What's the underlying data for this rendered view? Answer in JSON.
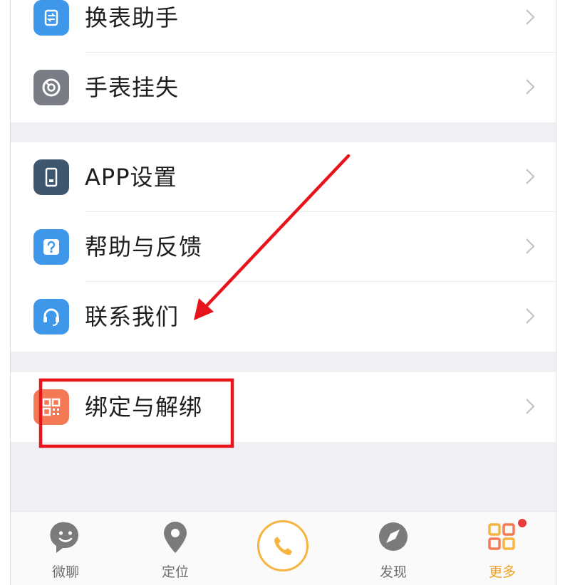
{
  "colors": {
    "accent": "#f7b43f",
    "annotation": "#e8141b",
    "icon_blue": "#3f97ea",
    "icon_gray": "#7a7d85",
    "icon_navy": "#3e566e",
    "icon_orange": "#f47a55"
  },
  "groups": [
    {
      "items": [
        {
          "label": "换表助手",
          "icon": "watch-swap-icon"
        },
        {
          "label": "手表挂失",
          "icon": "report-lost-icon"
        }
      ]
    },
    {
      "items": [
        {
          "label": "APP设置",
          "icon": "phone-settings-icon"
        },
        {
          "label": "帮助与反馈",
          "icon": "question-icon"
        },
        {
          "label": "联系我们",
          "icon": "headset-icon"
        }
      ]
    },
    {
      "items": [
        {
          "label": "绑定与解绑",
          "icon": "qr-code-icon"
        }
      ]
    }
  ],
  "tabbar": {
    "tabs": [
      {
        "label": "微聊",
        "icon": "chat-face-icon"
      },
      {
        "label": "定位",
        "icon": "location-pin-icon"
      },
      {
        "label": "",
        "icon": "phone-call-icon"
      },
      {
        "label": "发现",
        "icon": "compass-icon"
      },
      {
        "label": "更多",
        "icon": "more-grid-icon",
        "badge": true,
        "active": true
      }
    ]
  }
}
